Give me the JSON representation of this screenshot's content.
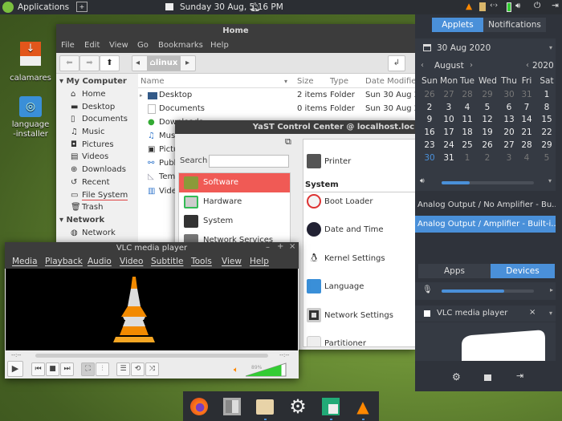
{
  "top_panel": {
    "apps_label": "Applications",
    "clock": "Sunday 30 Aug,  5:16 PM"
  },
  "desktop_icons": [
    {
      "label": "calamares"
    },
    {
      "label": "language-installer"
    }
  ],
  "files": {
    "title": "Home",
    "menu": [
      "File",
      "Edit",
      "View",
      "Go",
      "Bookmarks",
      "Help"
    ],
    "breadcrumb": "linux",
    "sidebar": {
      "sections": [
        {
          "title": "My Computer",
          "items": [
            "Home",
            "Desktop",
            "Documents",
            "Music",
            "Pictures",
            "Videos",
            "Downloads",
            "Recent",
            "File System",
            "Trash"
          ]
        },
        {
          "title": "Network",
          "items": [
            "Network"
          ]
        }
      ]
    },
    "columns": [
      "Name",
      "Size",
      "Type",
      "Date Modified"
    ],
    "rows": [
      {
        "name": "Desktop",
        "size": "2 items",
        "type": "Folder",
        "date": "Sun 30 Aug 20"
      },
      {
        "name": "Documents",
        "size": "0 items",
        "type": "Folder",
        "date": "Sun 30 Aug 20"
      },
      {
        "name": "Downloads"
      },
      {
        "name": "Music"
      },
      {
        "name": "Pictures"
      },
      {
        "name": "Public"
      },
      {
        "name": "Templates"
      },
      {
        "name": "Videos"
      }
    ]
  },
  "yast": {
    "title": "YaST Control Center @ localhost.loc",
    "search_label": "Search",
    "search_value": "",
    "categories": [
      "Software",
      "Hardware",
      "System",
      "Network Services"
    ],
    "printer": "Printer",
    "section": "System",
    "modules": [
      "Boot Loader",
      "Date and Time",
      "Kernel Settings",
      "Language",
      "Network Settings",
      "Partitioner"
    ]
  },
  "vlc": {
    "title": "VLC media player",
    "menu": [
      "Media",
      "Playback",
      "Audio",
      "Video",
      "Subtitle",
      "Tools",
      "View",
      "Help"
    ],
    "time_elapsed": "--:--",
    "time_total": "--:--",
    "volume_label": "89%",
    "volume": 0.89
  },
  "applets": {
    "tabs": [
      "Applets",
      "Notifications"
    ],
    "date": "30 Aug 2020",
    "month": "August",
    "year": "2020",
    "weekdays": [
      "Sun",
      "Mon",
      "Tue",
      "Wed",
      "Thu",
      "Fri",
      "Sat"
    ],
    "weeks": [
      [
        "26",
        "27",
        "28",
        "29",
        "30",
        "31",
        "1"
      ],
      [
        "2",
        "3",
        "4",
        "5",
        "6",
        "7",
        "8"
      ],
      [
        "9",
        "10",
        "11",
        "12",
        "13",
        "14",
        "15"
      ],
      [
        "16",
        "17",
        "18",
        "19",
        "20",
        "21",
        "22"
      ],
      [
        "23",
        "24",
        "25",
        "26",
        "27",
        "28",
        "29"
      ],
      [
        "30",
        "31",
        "1",
        "2",
        "3",
        "4",
        "5"
      ]
    ],
    "output_volume": 0.3,
    "outputs": [
      "Analog Output / No Amplifier - Bu...",
      "Analog Output / Amplifier - Built-i..."
    ],
    "selected_output": 1,
    "sound_tabs": [
      "Apps",
      "Devices"
    ],
    "input_volume": 0.68,
    "media_player": "VLC media player"
  },
  "colors": {
    "accent": "#4a90d9",
    "yast_selected": "#f05a55",
    "vlc_orange": "#ff8800"
  }
}
